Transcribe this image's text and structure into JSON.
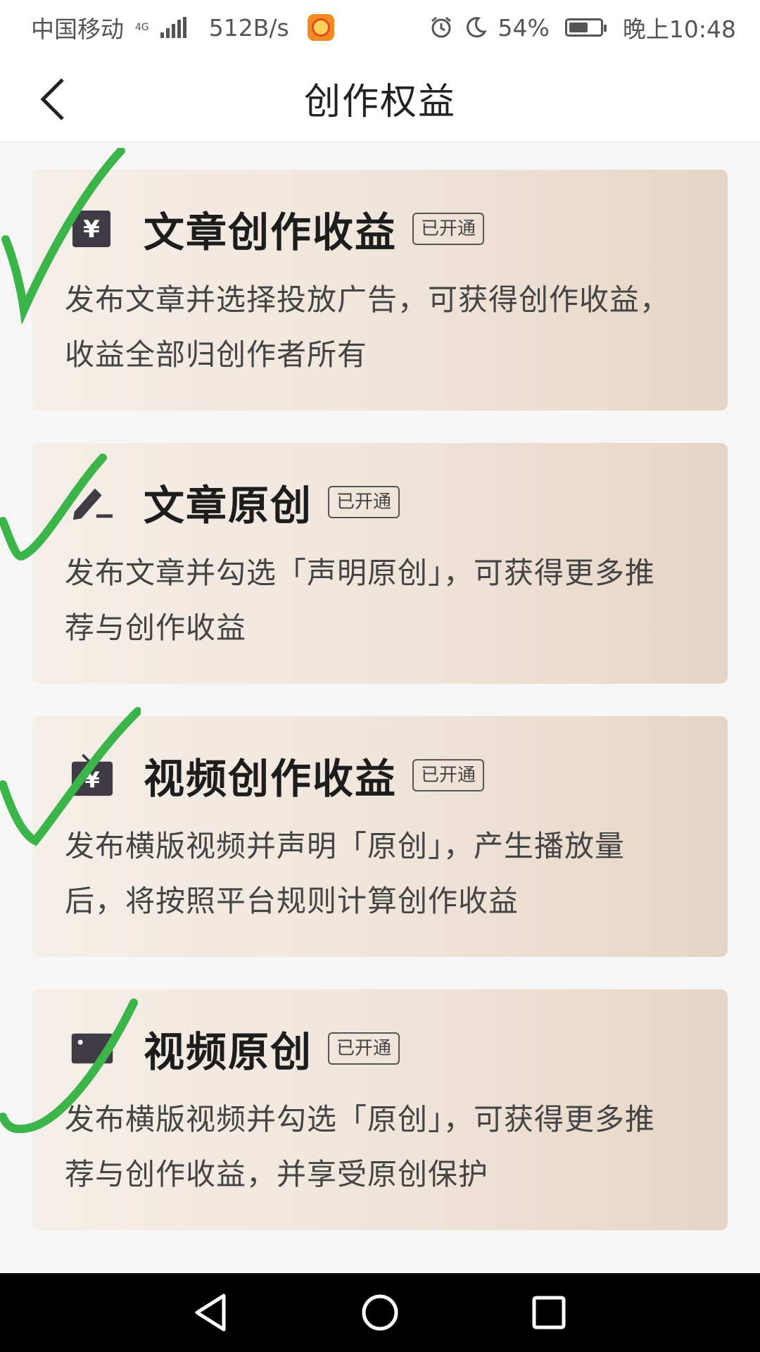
{
  "status_bar": {
    "carrier": "中国移动",
    "network_top": "4G",
    "network_speed": "512B/s",
    "battery": "54%",
    "time": "晚上10:48"
  },
  "header": {
    "title": "创作权益"
  },
  "cards": [
    {
      "title": "文章创作收益",
      "badge": "已开通",
      "desc": "发布文章并选择投放广告，可获得创作收益，收益全部归创作者所有",
      "icon": "yuan-doc-icon"
    },
    {
      "title": "文章原创",
      "badge": "已开通",
      "desc": "发布文章并勾选「声明原创」，可获得更多推荐与创作收益",
      "icon": "pen-icon"
    },
    {
      "title": "视频创作收益",
      "badge": "已开通",
      "desc": "发布横版视频并声明「原创」，产生播放量后，将按照平台规则计算创作收益",
      "icon": "tv-yuan-icon"
    },
    {
      "title": "视频原创",
      "badge": "已开通",
      "desc": "发布横版视频并勾选「原创」，可获得更多推荐与创作收益，并享受原创保护",
      "icon": "video-camera-icon"
    }
  ],
  "colors": {
    "check_mark": "#3bb44a",
    "card_start": "#f5efe9",
    "card_end": "#e6d5c6",
    "title": "#1d1d1d"
  }
}
